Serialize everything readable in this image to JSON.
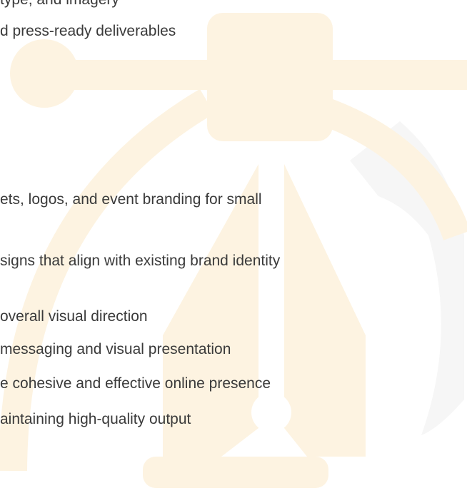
{
  "watermark_icon": "pen-tool-icon",
  "colors": {
    "text": "#3a3a3a",
    "watermark_gold": "#fdf3e1",
    "watermark_gray": "#f6f6f6"
  },
  "lines": [
    "type, and imagery",
    "d press-ready deliverables",
    "ets, logos, and event branding for small",
    "signs that align with existing brand identity",
    " overall visual direction",
    "messaging and visual presentation",
    "e cohesive and effective online presence",
    "aintaining high-quality output"
  ]
}
